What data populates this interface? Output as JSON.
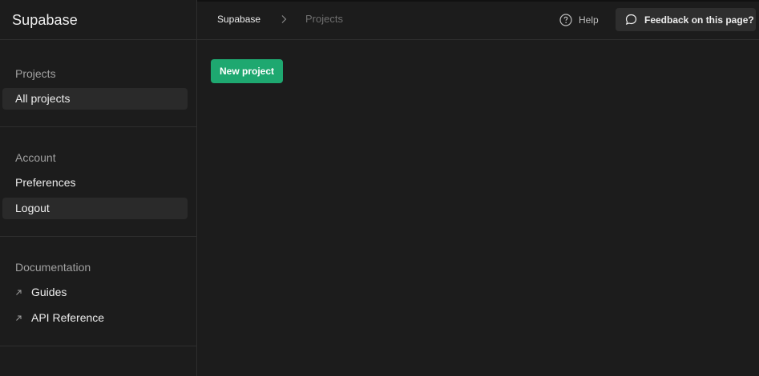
{
  "app": {
    "brand": "Supabase"
  },
  "sidebar": {
    "sections": [
      {
        "title": "Projects",
        "items": [
          {
            "label": "All projects",
            "active": true
          }
        ]
      },
      {
        "title": "Account",
        "items": [
          {
            "label": "Preferences",
            "active": false
          },
          {
            "label": "Logout",
            "active": true
          }
        ]
      },
      {
        "title": "Documentation",
        "items": [
          {
            "label": "Guides",
            "icon": "external-arrow-icon"
          },
          {
            "label": "API Reference",
            "icon": "external-arrow-icon"
          }
        ]
      }
    ]
  },
  "header": {
    "breadcrumb": [
      "Supabase",
      "Projects"
    ],
    "breadcrumb_separator_icon": "chevron-right-icon",
    "help_label": "Help",
    "help_icon": "question-circle-icon",
    "feedback_label": "Feedback on this page?",
    "feedback_icon": "message-circle-icon"
  },
  "main": {
    "new_project_label": "New project"
  },
  "colors": {
    "background": "#1c1c1c",
    "accent": "#1ea870",
    "border": "#2e2e2e",
    "muted_text": "#a0a0a0"
  }
}
